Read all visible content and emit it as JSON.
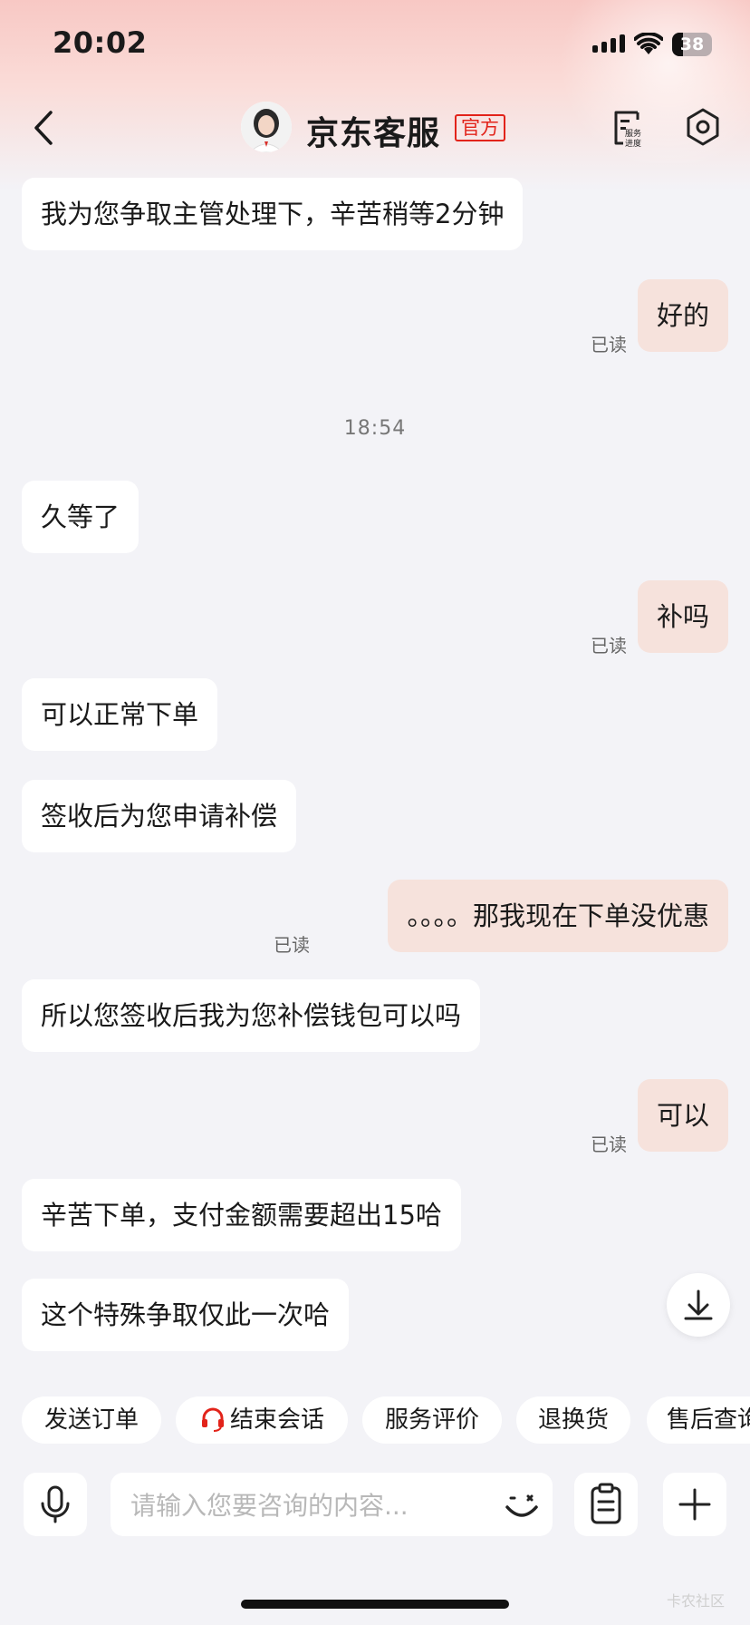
{
  "status_bar": {
    "time": "20:02",
    "battery": "38"
  },
  "header": {
    "title": "京东客服",
    "badge": "官方",
    "service_progress_line1": "服务",
    "service_progress_line2": "进度"
  },
  "messages": [
    {
      "side": "left",
      "text": "我为您争取主管处理下，辛苦稍等2分钟"
    },
    {
      "side": "right",
      "text": "好的",
      "status": "已读"
    },
    {
      "side": "left",
      "text": "久等了"
    },
    {
      "side": "right",
      "text": "补吗",
      "status": "已读"
    },
    {
      "side": "left",
      "text": "可以正常下单"
    },
    {
      "side": "left",
      "text": "签收后为您申请补偿"
    },
    {
      "side": "right",
      "text": "。。。。那我现在下单没优惠",
      "status": "已读"
    },
    {
      "side": "left",
      "text": "所以您签收后我为您补偿钱包可以吗"
    },
    {
      "side": "right",
      "text": "可以",
      "status": "已读"
    },
    {
      "side": "left",
      "text": "辛苦下单，支付金额需要超出15哈"
    },
    {
      "side": "left",
      "text": "这个特殊争取仅此一次哈"
    }
  ],
  "timestamp": "18:54",
  "quick_actions": [
    "发送订单",
    "结束会话",
    "服务评价",
    "退换货",
    "售后查询"
  ],
  "input": {
    "placeholder": "请输入您要咨询的内容...",
    "value": ""
  },
  "watermark": "卡农社区",
  "colors": {
    "accent": "#e2231a",
    "right_bubble": "#f6e2dc",
    "left_bubble": "#ffffff",
    "background": "#f3f3f7"
  }
}
